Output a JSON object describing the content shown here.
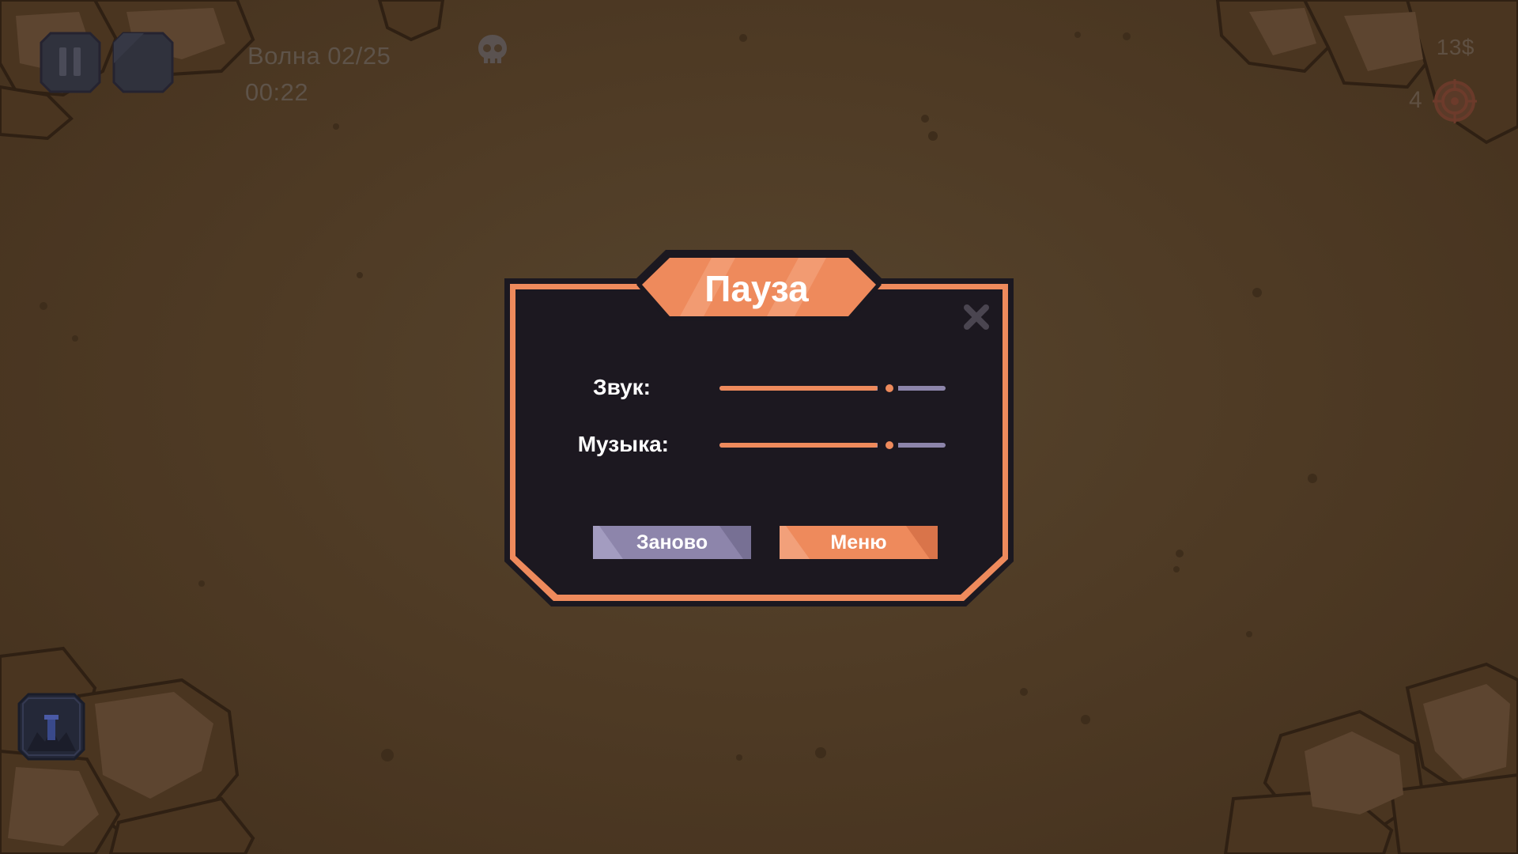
{
  "hud": {
    "wave_label": "Волна 02/25",
    "timer": "00:22",
    "money": "13$",
    "lives": "4",
    "icons": [
      "pause-icon",
      "fast-forward-icon",
      "skull-icon",
      "target-icon",
      "tower-icon"
    ]
  },
  "pause_menu": {
    "title": "Пауза",
    "sound_label": "Звук:",
    "sound_level": 0.75,
    "music_label": "Музыка:",
    "music_level": 0.75,
    "restart_label": "Заново",
    "menu_label": "Меню",
    "close_icon": "close-icon"
  },
  "colors": {
    "accent": "#ee8a5c",
    "panel": "#1c1820",
    "muted_purple": "#8d85ab",
    "background": "#4f3b25"
  }
}
